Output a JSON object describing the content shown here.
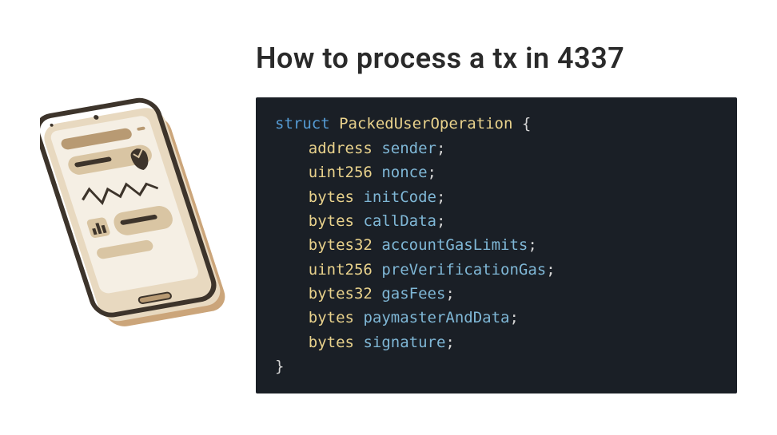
{
  "heading": "How to process a tx in 4337",
  "code": {
    "keyword": "struct",
    "struct_name": "PackedUserOperation",
    "open_brace": "{",
    "close_brace": "}",
    "fields": [
      {
        "type": "address",
        "name": "sender"
      },
      {
        "type": "uint256",
        "name": "nonce"
      },
      {
        "type": "bytes",
        "name": "initCode"
      },
      {
        "type": "bytes",
        "name": "callData"
      },
      {
        "type": "bytes32",
        "name": "accountGasLimits"
      },
      {
        "type": "uint256",
        "name": "preVerificationGas"
      },
      {
        "type": "bytes32",
        "name": "gasFees"
      },
      {
        "type": "bytes",
        "name": "paymasterAndData"
      },
      {
        "type": "bytes",
        "name": "signature"
      }
    ]
  },
  "illustration": {
    "name": "isometric-tablet-device",
    "colors": {
      "frame_dark": "#3d342b",
      "frame_mid": "#b89a73",
      "frame_light": "#e8d9c0",
      "screen": "#f5efe4",
      "accent": "#d9c5a3"
    }
  }
}
